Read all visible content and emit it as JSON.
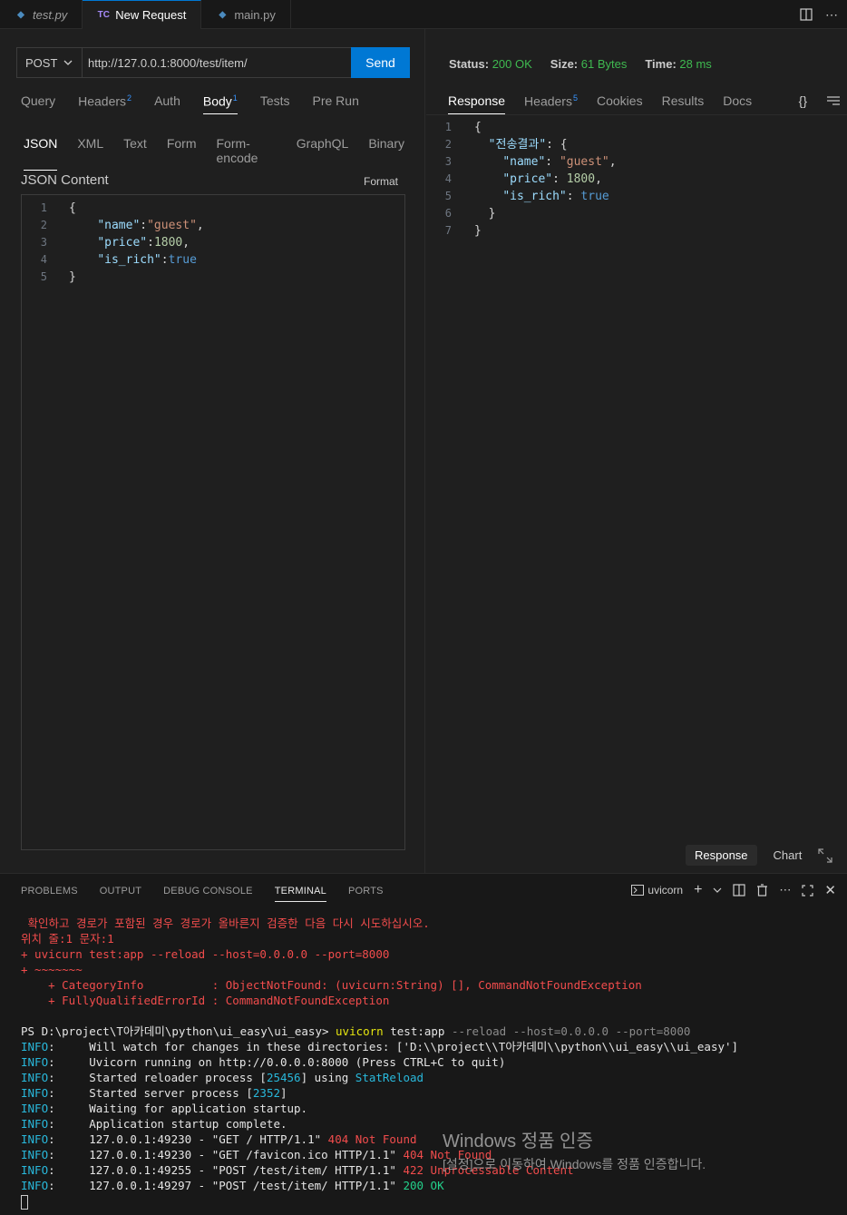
{
  "tabs": [
    {
      "label": "test.py",
      "icon": "python-file-icon",
      "active": false
    },
    {
      "label": "New Request",
      "icon": "thunder-client-icon",
      "active": true
    },
    {
      "label": "main.py",
      "icon": "python-file-icon",
      "active": false
    }
  ],
  "tab_icon_text": "TC",
  "request": {
    "method": "POST",
    "url": "http://127.0.0.1:8000/test/item/",
    "send_label": "Send",
    "tabs": [
      {
        "label": "Query"
      },
      {
        "label": "Headers",
        "badge": "2"
      },
      {
        "label": "Auth"
      },
      {
        "label": "Body",
        "badge": "1",
        "active": true
      },
      {
        "label": "Tests"
      },
      {
        "label": "Pre Run"
      }
    ],
    "body_types": [
      "JSON",
      "XML",
      "Text",
      "Form",
      "Form-encode",
      "GraphQL",
      "Binary"
    ],
    "json_title": "JSON Content",
    "format_label": "Format",
    "editor_lines": [
      {
        "n": "1",
        "parts": [
          [
            "p",
            "{"
          ]
        ]
      },
      {
        "n": "2",
        "parts": [
          [
            "p",
            "    "
          ],
          [
            "k",
            "\"name\""
          ],
          [
            "p",
            ":"
          ],
          [
            "s",
            "\"guest\""
          ],
          [
            "p",
            ","
          ]
        ]
      },
      {
        "n": "3",
        "parts": [
          [
            "p",
            "    "
          ],
          [
            "k",
            "\"price\""
          ],
          [
            "p",
            ":"
          ],
          [
            "n",
            "1800"
          ],
          [
            "p",
            ","
          ]
        ]
      },
      {
        "n": "4",
        "parts": [
          [
            "p",
            "    "
          ],
          [
            "k",
            "\"is_rich\""
          ],
          [
            "p",
            ":"
          ],
          [
            "b",
            "true"
          ]
        ]
      },
      {
        "n": "5",
        "parts": [
          [
            "p",
            "}"
          ]
        ]
      }
    ]
  },
  "response": {
    "status_label": "Status:",
    "status_value": "200 OK",
    "size_label": "Size:",
    "size_value": "61 Bytes",
    "time_label": "Time:",
    "time_value": "28 ms",
    "tabs": [
      {
        "label": "Response",
        "active": true
      },
      {
        "label": "Headers",
        "badge": "5"
      },
      {
        "label": "Cookies"
      },
      {
        "label": "Results"
      },
      {
        "label": "Docs"
      }
    ],
    "braces_label": "{}",
    "lines": [
      {
        "n": "1",
        "parts": [
          [
            "p",
            "{"
          ]
        ]
      },
      {
        "n": "2",
        "parts": [
          [
            "p",
            "  "
          ],
          [
            "k",
            "\"전송결과\""
          ],
          [
            "p",
            ": {"
          ]
        ]
      },
      {
        "n": "3",
        "parts": [
          [
            "p",
            "    "
          ],
          [
            "k",
            "\"name\""
          ],
          [
            "p",
            ": "
          ],
          [
            "s",
            "\"guest\""
          ],
          [
            "p",
            ","
          ]
        ]
      },
      {
        "n": "4",
        "parts": [
          [
            "p",
            "    "
          ],
          [
            "k",
            "\"price\""
          ],
          [
            "p",
            ": "
          ],
          [
            "n",
            "1800"
          ],
          [
            "p",
            ","
          ]
        ]
      },
      {
        "n": "5",
        "parts": [
          [
            "p",
            "    "
          ],
          [
            "k",
            "\"is_rich\""
          ],
          [
            "p",
            ": "
          ],
          [
            "b",
            "true"
          ]
        ]
      },
      {
        "n": "6",
        "parts": [
          [
            "p",
            "  }"
          ]
        ]
      },
      {
        "n": "7",
        "parts": [
          [
            "p",
            "}"
          ]
        ]
      }
    ],
    "bottom_tabs": [
      {
        "label": "Response",
        "active": true
      },
      {
        "label": "Chart"
      }
    ]
  },
  "terminal": {
    "tabs": [
      {
        "label": "PROBLEMS"
      },
      {
        "label": "OUTPUT"
      },
      {
        "label": "DEBUG CONSOLE"
      },
      {
        "label": "TERMINAL",
        "active": true
      },
      {
        "label": "PORTS"
      }
    ],
    "shell_name": "uvicorn",
    "lines": [
      [
        [
          "red",
          " 확인하고 경로가 포함된 경우 경로가 올바른지 검증한 다음 다시 시도하십시오."
        ]
      ],
      [
        [
          "red",
          "위치 줄:1 문자:1"
        ]
      ],
      [
        [
          "red",
          "+ uvicurn test:app --reload --host=0.0.0.0 --port=8000"
        ]
      ],
      [
        [
          "red",
          "+ ~~~~~~~"
        ]
      ],
      [
        [
          "red",
          "    + CategoryInfo          : ObjectNotFound: (uvicurn:String) [], CommandNotFoundException"
        ]
      ],
      [
        [
          "red",
          "    + FullyQualifiedErrorId : CommandNotFoundException"
        ]
      ],
      [
        [
          "wht",
          " "
        ]
      ],
      [
        [
          "wht",
          "PS D:\\project\\T아카데미\\python\\ui_easy\\ui_easy> "
        ],
        [
          "yel",
          "uvicorn"
        ],
        [
          "wht",
          " test:app "
        ],
        [
          "gry",
          "--reload --host=0.0.0.0 --port=8000"
        ]
      ],
      [
        [
          "info",
          "INFO"
        ],
        [
          "wht",
          ":     Will watch for changes in these directories: ['D:\\\\project\\\\T아카데미\\\\python\\\\ui_easy\\\\ui_easy']"
        ]
      ],
      [
        [
          "info",
          "INFO"
        ],
        [
          "wht",
          ":     Uvicorn running on "
        ],
        [
          "wht",
          "http://0.0.0.0:8000"
        ],
        [
          "wht",
          " (Press CTRL+C to quit)"
        ]
      ],
      [
        [
          "info",
          "INFO"
        ],
        [
          "wht",
          ":     Started reloader process ["
        ],
        [
          "cyan",
          "25456"
        ],
        [
          "wht",
          "] using "
        ],
        [
          "cyan",
          "StatReload"
        ]
      ],
      [
        [
          "info",
          "INFO"
        ],
        [
          "wht",
          ":     Started server process ["
        ],
        [
          "cyan",
          "2352"
        ],
        [
          "wht",
          "]"
        ]
      ],
      [
        [
          "info",
          "INFO"
        ],
        [
          "wht",
          ":     Waiting for application startup."
        ]
      ],
      [
        [
          "info",
          "INFO"
        ],
        [
          "wht",
          ":     Application startup complete."
        ]
      ],
      [
        [
          "info",
          "INFO"
        ],
        [
          "wht",
          ":     127.0.0.1:49230 - \"GET / HTTP/1.1\" "
        ],
        [
          "red",
          "404 Not Found"
        ]
      ],
      [
        [
          "info",
          "INFO"
        ],
        [
          "wht",
          ":     127.0.0.1:49230 - \"GET /favicon.ico HTTP/1.1\" "
        ],
        [
          "red",
          "404 Not Found"
        ]
      ],
      [
        [
          "info",
          "INFO"
        ],
        [
          "wht",
          ":     127.0.0.1:49255 - \"POST /test/item/ HTTP/1.1\" "
        ],
        [
          "red",
          "422 Unprocessable Content"
        ]
      ],
      [
        [
          "info",
          "INFO"
        ],
        [
          "wht",
          ":     127.0.0.1:49297 - \"POST /test/item/ HTTP/1.1\" "
        ],
        [
          "grn",
          "200 OK"
        ]
      ]
    ]
  },
  "watermark": {
    "title": "Windows 정품 인증",
    "subtitle": "[설정]으로 이동하여 Windows를 정품 인증합니다."
  },
  "colors": {
    "accent": "#0078d4",
    "ok_green": "#3fb950",
    "error_red": "#f14c4c"
  }
}
